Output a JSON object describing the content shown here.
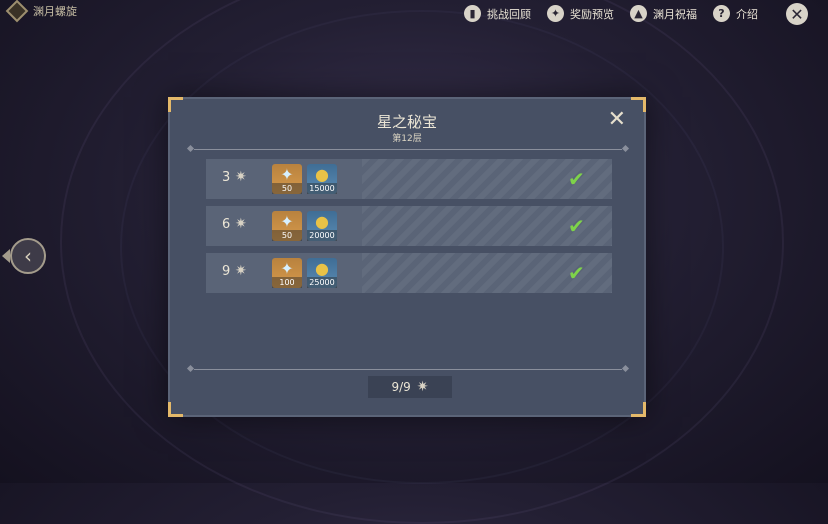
{
  "topbar": {
    "title": "渊月螺旋",
    "nav": [
      {
        "label": "挑战回顾",
        "icon": "book-icon"
      },
      {
        "label": "奖励预览",
        "icon": "reward-icon"
      },
      {
        "label": "渊月祝福",
        "icon": "blessing-icon"
      },
      {
        "label": "介绍",
        "icon": "question-icon"
      }
    ],
    "close_icon": "close-icon"
  },
  "dialog": {
    "title": "星之秘宝",
    "subtitle": "第12层",
    "rows": [
      {
        "stars": "3",
        "item_a_qty": "50",
        "item_b_qty": "15000",
        "claimed": true
      },
      {
        "stars": "6",
        "item_a_qty": "50",
        "item_b_qty": "20000",
        "claimed": true
      },
      {
        "stars": "9",
        "item_a_qty": "100",
        "item_b_qty": "25000",
        "claimed": true
      }
    ],
    "progress": "9/9"
  },
  "colors": {
    "accent": "#e4b96a",
    "check": "#7ed34a",
    "panel": "#475064"
  }
}
